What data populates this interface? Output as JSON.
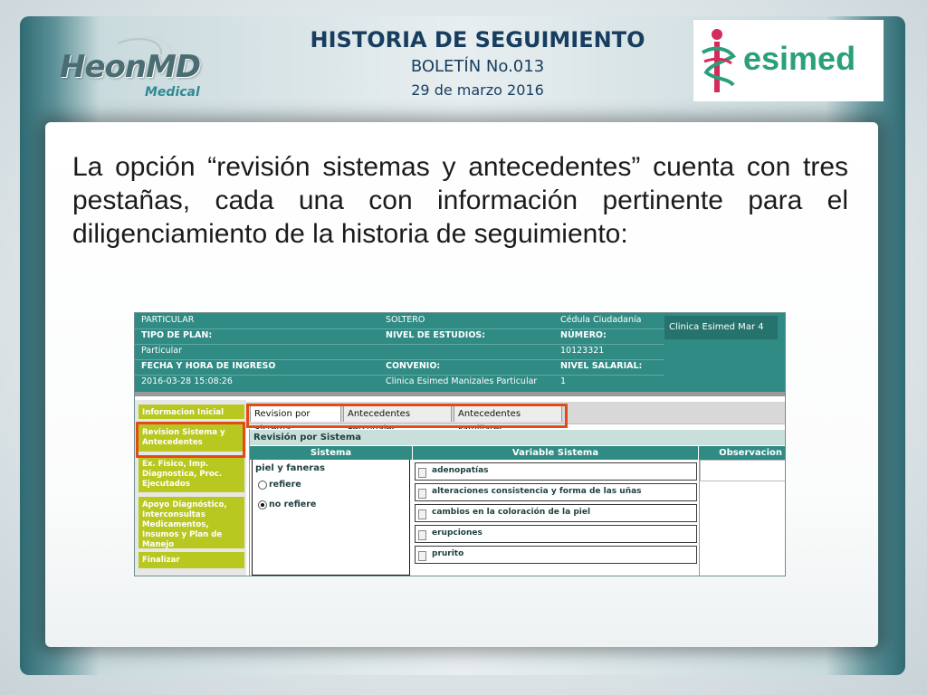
{
  "header": {
    "title": "HISTORIA DE SEGUIMIENTO",
    "subtitle": "BOLETÍN No.013",
    "date": "29 de marzo 2016"
  },
  "logos": {
    "left_main": "HeonMD",
    "left_sub": "Medical",
    "right": "esimed"
  },
  "body_text": "La opción “revisión sistemas y antecedentes” cuenta con tres pestañas, cada una con información pertinente para el diligenciamiento de la historia de seguimiento:",
  "screenshot": {
    "info": {
      "col1": [
        "PARTICULAR",
        "TIPO DE PLAN:",
        "Particular",
        "FECHA Y HORA DE INGRESO",
        "2016-03-28 15:08:26"
      ],
      "col2": [
        "SOLTERO",
        "NIVEL DE ESTUDIOS:",
        "",
        "CONVENIO:",
        "Clinica Esimed Manizales Particular"
      ],
      "col3": [
        "Cédula Ciudadanía",
        "NÚMERO:",
        "10123321",
        "NIVEL SALARIAL:",
        "1"
      ],
      "clinic": "Clinica Esimed  Mar  4"
    },
    "side_menu": [
      "Informacion Inicial",
      "Revision Sistema y Antecedentes",
      "Ex. Fisico, Imp. Diagnostica, Proc. Ejecutados",
      "Apoyo Diagnóstico, Interconsultas Medicamentos, Insumos y Plan de Manejo",
      "Finalizar"
    ],
    "tabs": [
      "Revision por Sistema",
      "Antecedentes Personales",
      "Antecedentes Familiares"
    ],
    "section_title": "Revisión por Sistema",
    "columns": [
      "Sistema",
      "Variable Sistema",
      "Observacion"
    ],
    "system": {
      "label": "piel y faneras",
      "options": [
        "refiere",
        "no refiere"
      ],
      "selected": "no refiere"
    },
    "variables": [
      "adenopatías",
      "alteraciones consistencia y forma de las uñas",
      "cambios en la coloración de la piel",
      "erupciones",
      "prurito"
    ]
  },
  "colors": {
    "title": "#173e5f",
    "teal": "#2f8b84",
    "menu_green": "#b9c820",
    "highlight": "#e04c18",
    "esimed_green": "#2aa07a"
  }
}
